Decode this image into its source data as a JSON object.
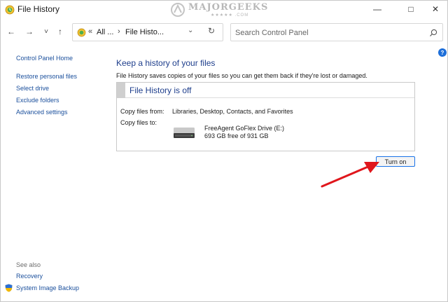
{
  "window": {
    "title": "File History",
    "watermark": "MAJORGEEKS",
    "watermark_sub": "★★★★★ .COM",
    "controls": {
      "minimize": "—",
      "maximize": "□",
      "close": "✕"
    }
  },
  "navigation": {
    "back": "←",
    "forward": "→",
    "recent": "˅",
    "up": "↑",
    "address": {
      "overflow": "«",
      "crumb1": "All ...",
      "separator": "›",
      "crumb2": "File Histo...",
      "dropdown": "⌄",
      "refresh": "↻"
    },
    "search": {
      "placeholder": "Search Control Panel"
    }
  },
  "help": {
    "label": "?"
  },
  "sidebar": {
    "home": "Control Panel Home",
    "items": [
      {
        "label": "Restore personal files"
      },
      {
        "label": "Select drive"
      },
      {
        "label": "Exclude folders"
      },
      {
        "label": "Advanced settings"
      }
    ],
    "see_also": {
      "title": "See also",
      "items": [
        {
          "label": "Recovery"
        },
        {
          "label": "System Image Backup"
        }
      ]
    }
  },
  "main": {
    "heading": "Keep a history of your files",
    "description": "File History saves copies of your files so you can get them back if they're lost or damaged.",
    "status": {
      "title": "File History is off",
      "copy_from_label": "Copy files from:",
      "copy_from_value": "Libraries, Desktop, Contacts, and Favorites",
      "copy_to_label": "Copy files to:",
      "drive_name": "FreeAgent GoFlex Drive (E:)",
      "drive_free": "693 GB free of 931 GB"
    },
    "turn_on": "Turn on"
  },
  "colors": {
    "heading": "#1e3e8c",
    "link": "#1a4f9c",
    "button_border": "#1a73e8",
    "annotation_arrow": "#e0161c"
  }
}
